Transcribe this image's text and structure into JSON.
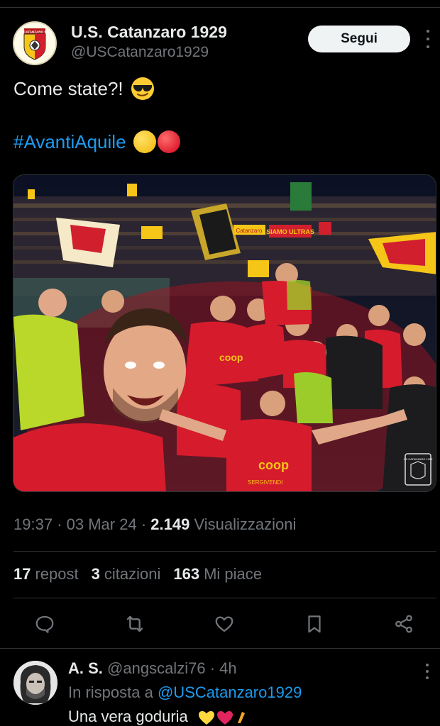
{
  "tweet": {
    "author": {
      "display_name": "U.S. Catanzaro 1929",
      "handle": "@USCatanzaro1929",
      "crest_text": "US CATANZARO 1929"
    },
    "follow_label": "Segui",
    "text": "Come state?!",
    "hashtag": "#AvantiAquile",
    "photo": {
      "banners": [
        "SIAMO ULTRAS",
        "Catanzaro",
        "coop",
        "coop",
        "SERGIVENDI"
      ],
      "logo_text": "US CATANZARO 1929"
    },
    "meta": {
      "time": "19:37",
      "date": "03 Mar 24",
      "views": "2.149",
      "views_label": "Visualizzazioni",
      "sep": "·"
    },
    "stats": {
      "reposts": "17",
      "reposts_label": "repost",
      "quotes": "3",
      "quotes_label": "citazioni",
      "likes": "163",
      "likes_label": "Mi piace"
    }
  },
  "reply": {
    "name": "A. S.",
    "handle": "@angscalzi76",
    "time": "4h",
    "sep": "·",
    "in_reply_prefix": "In risposta a",
    "in_reply_mention": "@USCatanzaro1929",
    "text": "Una vera goduria"
  },
  "icons": {
    "reply": "reply-icon",
    "repost": "repost-icon",
    "like": "heart-icon",
    "bookmark": "bookmark-icon",
    "share": "share-icon"
  },
  "colors": {
    "background": "#000000",
    "text": "#e7e9ea",
    "muted": "#71767b",
    "link": "#1d9bf0",
    "divider": "#2f3336",
    "team_red": "#d11f2e",
    "team_yellow": "#f5c518"
  }
}
